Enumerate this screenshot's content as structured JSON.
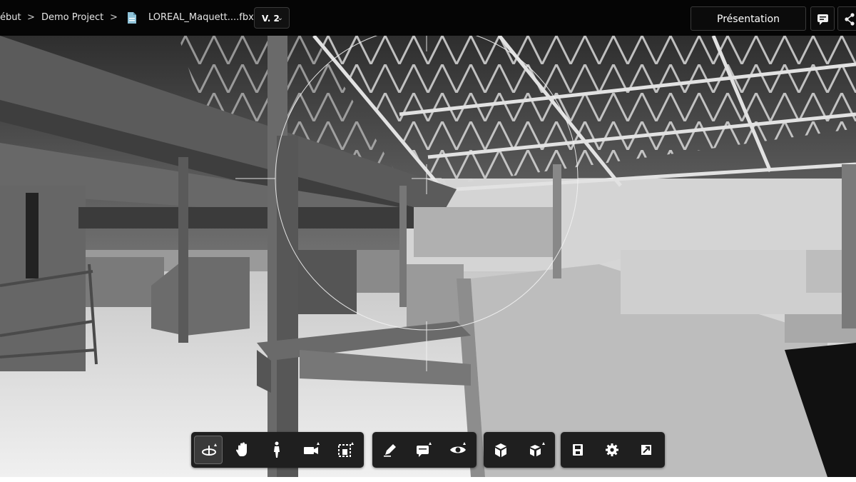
{
  "breadcrumb": {
    "root": "ébut",
    "project": "Demo Project",
    "file": "LOREAL_Maquett....fbx",
    "separator": ">"
  },
  "version": {
    "label": "V. 2"
  },
  "header": {
    "presentation_label": "Présentation"
  },
  "toolbar": {
    "groups": [
      {
        "tools": [
          "orbit-icon",
          "hand-pan-icon",
          "person-walk-icon",
          "camera-icon",
          "section-box-icon"
        ],
        "active": "orbit-icon"
      },
      {
        "tools": [
          "pen-annotate-icon",
          "comment-icon",
          "eye-icon"
        ]
      },
      {
        "tools": [
          "cube-icon",
          "cube-explode-icon"
        ]
      },
      {
        "tools": [
          "save-icon",
          "gear-icon",
          "fullscreen-icon"
        ]
      }
    ]
  },
  "colors": {
    "topbar": "#050505",
    "toolbar": "#1f1f1f",
    "active_tool": "#3a3a3a"
  }
}
